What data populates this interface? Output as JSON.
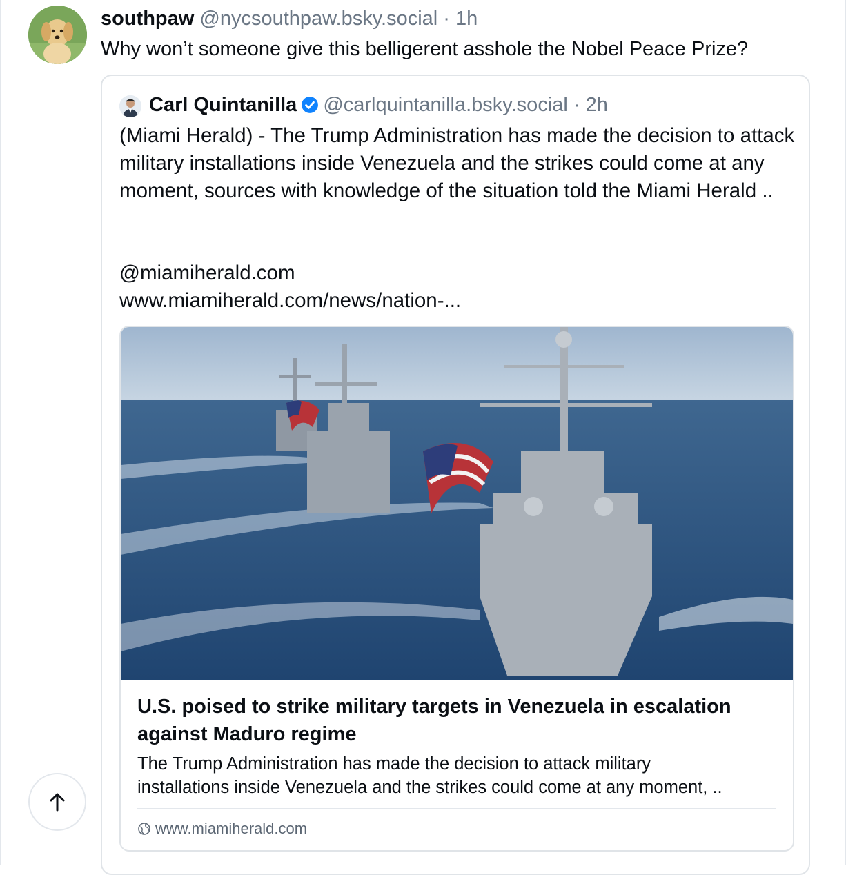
{
  "post": {
    "display_name": "southpaw",
    "handle_time": "@nycsouthpaw.bsky.social · 1h",
    "text": "Why won’t someone give this belligerent asshole the Nobel Peace Prize?",
    "avatar_icon": "golden-retriever-puppy-avatar"
  },
  "quote": {
    "display_name": "Carl Quintanilla",
    "verified_icon": "verified-check-icon",
    "handle_time": "@carlquintanilla.bsky.social · 2h",
    "body": "(Miami Herald) - The Trump Administration has made the decision to attack military installations inside Venezuela and the strikes could come at any moment, sources with knowledge of the situation told the Miami Herald ..",
    "mention": "@miamiherald.com",
    "url": "www.miamiherald.com/news/nation-..."
  },
  "link_card": {
    "image_icon": "navy-destroyers-photo",
    "title": "U.S. poised to strike military targets in Venezuela in escalation against Maduro regime",
    "description_line1": "The Trump Administration has made the decision to attack military",
    "description_line2": "installations inside Venezuela and the strikes could come at any moment, ..",
    "source": "www.miamiherald.com"
  },
  "controls": {
    "scroll_top_icon": "arrow-up-icon"
  },
  "colors": {
    "text": "#0b0f14",
    "muted": "#6b7785",
    "border": "#e0e4e8",
    "verified": "#1083fe"
  }
}
